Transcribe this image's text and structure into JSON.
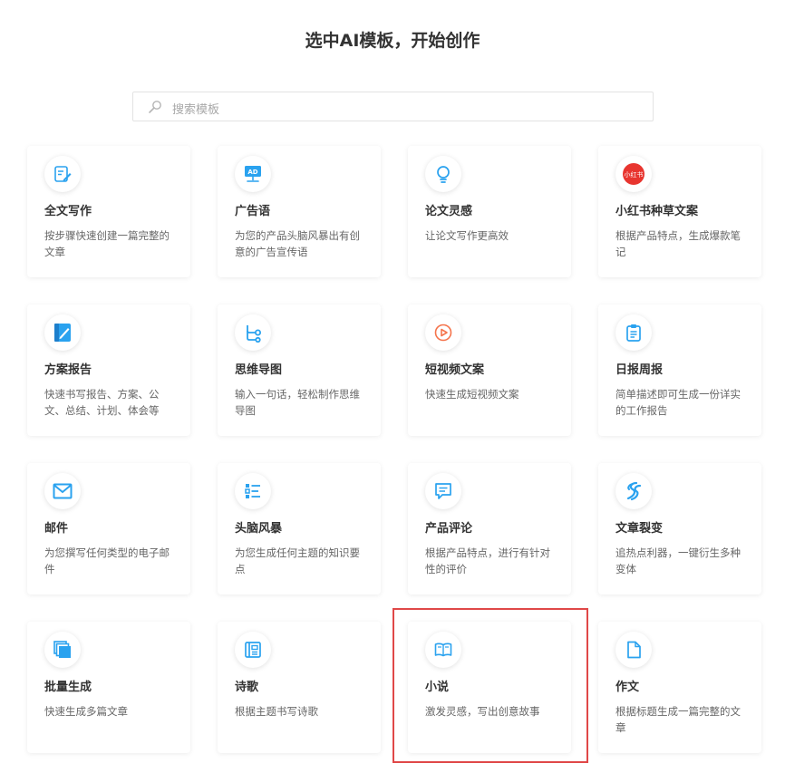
{
  "header": {
    "title": "选中AI模板，开始创作"
  },
  "search": {
    "placeholder": "搜索模板"
  },
  "colors": {
    "accent": "#2aa2ef",
    "red": "#e8352f",
    "orange": "#f5744c",
    "highlight": "#e04848"
  },
  "cards": [
    {
      "title": "全文写作",
      "desc": "按步骤快速创建一篇完整的文章",
      "icon": "edit-doc-icon"
    },
    {
      "title": "广告语",
      "desc": "为您的产品头脑风暴出有创意的广告宣传语",
      "icon": "ad-icon"
    },
    {
      "title": "论文灵感",
      "desc": "让论文写作更高效",
      "icon": "lightbulb-icon"
    },
    {
      "title": "小红书种草文案",
      "desc": "根据产品特点，生成爆款笔记",
      "icon": "xiaohongshu-icon",
      "icon_text": "小红书"
    },
    {
      "title": "方案报告",
      "desc": "快速书写报告、方案、公文、总结、计划、体会等",
      "icon": "notebook-icon"
    },
    {
      "title": "思维导图",
      "desc": "输入一句话，轻松制作思维导图",
      "icon": "mindmap-icon"
    },
    {
      "title": "短视频文案",
      "desc": "快速生成短视频文案",
      "icon": "video-play-icon"
    },
    {
      "title": "日报周报",
      "desc": "简单描述即可生成一份详实的工作报告",
      "icon": "clipboard-icon"
    },
    {
      "title": "邮件",
      "desc": "为您撰写任何类型的电子邮件",
      "icon": "mail-icon"
    },
    {
      "title": "头脑风暴",
      "desc": "为您生成任何主题的知识要点",
      "icon": "list-icon"
    },
    {
      "title": "产品评论",
      "desc": "根据产品特点，进行有针对性的评价",
      "icon": "comment-icon"
    },
    {
      "title": "文章裂变",
      "desc": "追热点利器，一键衍生多种变体",
      "icon": "split-icon"
    },
    {
      "title": "批量生成",
      "desc": "快速生成多篇文章",
      "icon": "stack-icon"
    },
    {
      "title": "诗歌",
      "desc": "根据主题书写诗歌",
      "icon": "poem-icon"
    },
    {
      "title": "小说",
      "desc": "激发灵感，写出创意故事",
      "icon": "book-icon"
    },
    {
      "title": "作文",
      "desc": "根据标题生成一篇完整的文章",
      "icon": "file-icon"
    }
  ]
}
